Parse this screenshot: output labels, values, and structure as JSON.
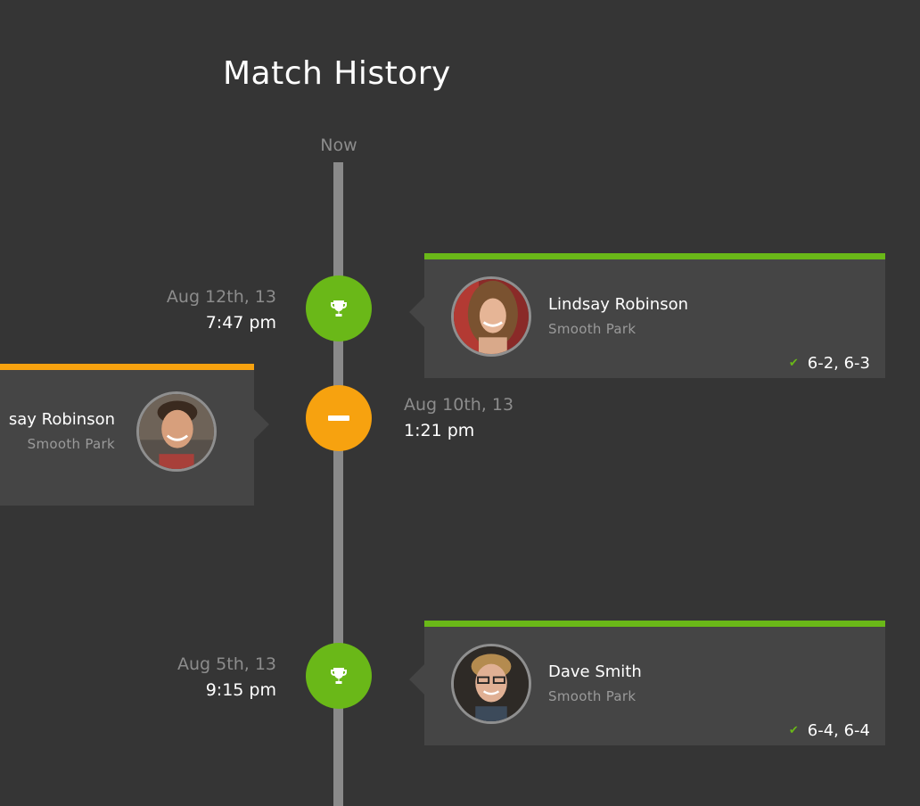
{
  "page": {
    "title": "Match History"
  },
  "timeline": {
    "now_label": "Now"
  },
  "matches": [
    {
      "result": "win",
      "result_icon": "trophy-icon",
      "date": "Aug 12th, 13",
      "time": "7:47 pm",
      "opponent": "Lindsay Robinson",
      "venue": "Smooth Park",
      "score": "6-2, 6-3"
    },
    {
      "result": "draw",
      "result_icon": "minus-icon",
      "date": "Aug 10th, 13",
      "time": "1:21 pm",
      "opponent": "say Robinson",
      "venue": "Smooth Park"
    },
    {
      "result": "win",
      "result_icon": "trophy-icon",
      "date": "Aug 5th, 13",
      "time": "9:15 pm",
      "opponent": "Dave Smith",
      "venue": "Smooth Park",
      "score": "6-4, 6-4"
    }
  ],
  "colors": {
    "background": "#353535",
    "card": "#454545",
    "win": "#6ab818",
    "draw": "#f7a20f",
    "timeline": "#8a8a8a",
    "muted_text": "#8c8c8c"
  }
}
